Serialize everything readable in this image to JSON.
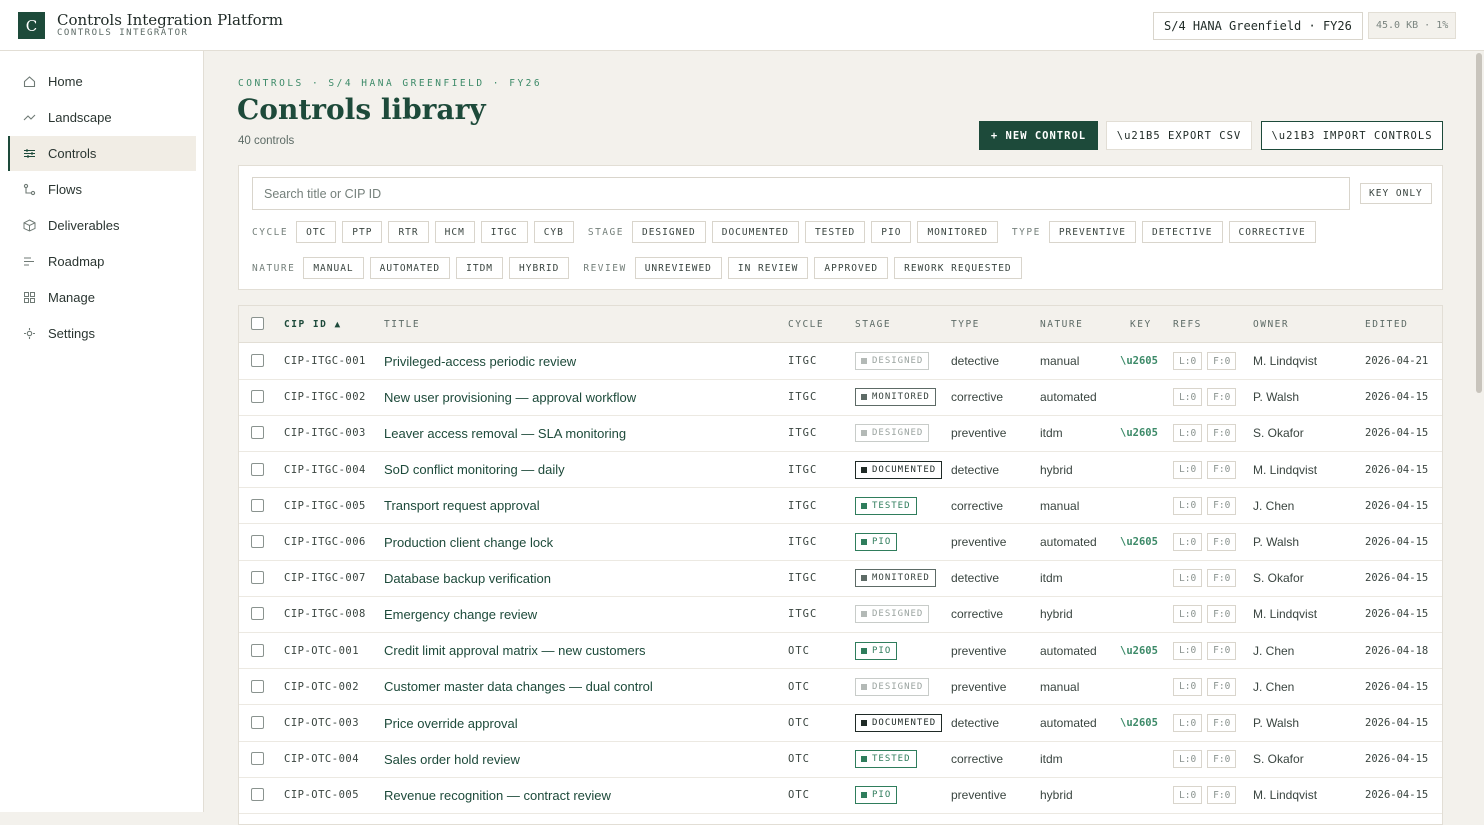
{
  "app": {
    "logo_letter": "C",
    "title": "Controls Integration Platform",
    "subtitle": "CONTROLS INTEGRATOR",
    "project": "S/4 HANA Greenfield · FY26",
    "storage": "45.0 KB · 1%"
  },
  "sidebar": {
    "items": [
      {
        "label": "Home",
        "icon": "home-icon"
      },
      {
        "label": "Landscape",
        "icon": "trend-icon"
      },
      {
        "label": "Controls",
        "icon": "sliders-icon",
        "active": true
      },
      {
        "label": "Flows",
        "icon": "flow-icon"
      },
      {
        "label": "Deliverables",
        "icon": "cube-icon"
      },
      {
        "label": "Roadmap",
        "icon": "roadmap-icon"
      },
      {
        "label": "Manage",
        "icon": "grid-icon"
      },
      {
        "label": "Settings",
        "icon": "gear-icon"
      }
    ]
  },
  "page": {
    "breadcrumb": "CONTROLS · S/4 HANA GREENFIELD · FY26",
    "title": "Controls library",
    "count": "40 controls"
  },
  "actions": {
    "new_control": "+ NEW CONTROL",
    "export_csv": "\\u21B5 EXPORT CSV",
    "import_controls": "\\u21B3 IMPORT CONTROLS"
  },
  "filters": {
    "search_placeholder": "Search title or CIP ID",
    "key_only": "KEY ONLY",
    "cycle_label": "CYCLE",
    "cycle": [
      "OTC",
      "PTP",
      "RTR",
      "HCM",
      "ITGC",
      "CYB"
    ],
    "stage_label": "STAGE",
    "stage": [
      "DESIGNED",
      "DOCUMENTED",
      "TESTED",
      "PIO",
      "MONITORED"
    ],
    "type_label": "TYPE",
    "type": [
      "PREVENTIVE",
      "DETECTIVE",
      "CORRECTIVE"
    ],
    "nature_label": "NATURE",
    "nature": [
      "MANUAL",
      "AUTOMATED",
      "ITDM",
      "HYBRID"
    ],
    "review_label": "REVIEW",
    "review": [
      "UNREVIEWED",
      "IN REVIEW",
      "APPROVED",
      "REWORK REQUESTED"
    ]
  },
  "table": {
    "columns": {
      "cip_id": "CIP ID ▲",
      "title": "TITLE",
      "cycle": "CYCLE",
      "stage": "STAGE",
      "type": "TYPE",
      "nature": "NATURE",
      "key": "KEY",
      "refs": "REFS",
      "owner": "OWNER",
      "edited": "EDITED"
    },
    "rows": [
      {
        "id": "CIP-ITGC-001",
        "title": "Privileged-access periodic review",
        "cycle": "ITGC",
        "stage": "DESIGNED",
        "stage_class": "designed",
        "type": "detective",
        "nature": "manual",
        "key": "\\u2605",
        "ref_l": "L:0",
        "ref_f": "F:0",
        "owner": "M. Lindqvist",
        "edited": "2026-04-21"
      },
      {
        "id": "CIP-ITGC-002",
        "title": "New user provisioning — approval workflow",
        "cycle": "ITGC",
        "stage": "MONITORED",
        "stage_class": "monitored",
        "type": "corrective",
        "nature": "automated",
        "key": "",
        "ref_l": "L:0",
        "ref_f": "F:0",
        "owner": "P. Walsh",
        "edited": "2026-04-15"
      },
      {
        "id": "CIP-ITGC-003",
        "title": "Leaver access removal — SLA monitoring",
        "cycle": "ITGC",
        "stage": "DESIGNED",
        "stage_class": "designed",
        "type": "preventive",
        "nature": "itdm",
        "key": "\\u2605",
        "ref_l": "L:0",
        "ref_f": "F:0",
        "owner": "S. Okafor",
        "edited": "2026-04-15"
      },
      {
        "id": "CIP-ITGC-004",
        "title": "SoD conflict monitoring — daily",
        "cycle": "ITGC",
        "stage": "DOCUMENTED",
        "stage_class": "documented",
        "type": "detective",
        "nature": "hybrid",
        "key": "",
        "ref_l": "L:0",
        "ref_f": "F:0",
        "owner": "M. Lindqvist",
        "edited": "2026-04-15"
      },
      {
        "id": "CIP-ITGC-005",
        "title": "Transport request approval",
        "cycle": "ITGC",
        "stage": "TESTED",
        "stage_class": "tested",
        "type": "corrective",
        "nature": "manual",
        "key": "",
        "ref_l": "L:0",
        "ref_f": "F:0",
        "owner": "J. Chen",
        "edited": "2026-04-15"
      },
      {
        "id": "CIP-ITGC-006",
        "title": "Production client change lock",
        "cycle": "ITGC",
        "stage": "PIO",
        "stage_class": "pio",
        "type": "preventive",
        "nature": "automated",
        "key": "\\u2605",
        "ref_l": "L:0",
        "ref_f": "F:0",
        "owner": "P. Walsh",
        "edited": "2026-04-15"
      },
      {
        "id": "CIP-ITGC-007",
        "title": "Database backup verification",
        "cycle": "ITGC",
        "stage": "MONITORED",
        "stage_class": "monitored",
        "type": "detective",
        "nature": "itdm",
        "key": "",
        "ref_l": "L:0",
        "ref_f": "F:0",
        "owner": "S. Okafor",
        "edited": "2026-04-15"
      },
      {
        "id": "CIP-ITGC-008",
        "title": "Emergency change review",
        "cycle": "ITGC",
        "stage": "DESIGNED",
        "stage_class": "designed",
        "type": "corrective",
        "nature": "hybrid",
        "key": "",
        "ref_l": "L:0",
        "ref_f": "F:0",
        "owner": "M. Lindqvist",
        "edited": "2026-04-15"
      },
      {
        "id": "CIP-OTC-001",
        "title": "Credit limit approval matrix — new customers",
        "cycle": "OTC",
        "stage": "PIO",
        "stage_class": "pio",
        "type": "preventive",
        "nature": "automated",
        "key": "\\u2605",
        "ref_l": "L:0",
        "ref_f": "F:0",
        "owner": "J. Chen",
        "edited": "2026-04-18"
      },
      {
        "id": "CIP-OTC-002",
        "title": "Customer master data changes — dual control",
        "cycle": "OTC",
        "stage": "DESIGNED",
        "stage_class": "designed",
        "type": "preventive",
        "nature": "manual",
        "key": "",
        "ref_l": "L:0",
        "ref_f": "F:0",
        "owner": "J. Chen",
        "edited": "2026-04-15"
      },
      {
        "id": "CIP-OTC-003",
        "title": "Price override approval",
        "cycle": "OTC",
        "stage": "DOCUMENTED",
        "stage_class": "documented",
        "type": "detective",
        "nature": "automated",
        "key": "\\u2605",
        "ref_l": "L:0",
        "ref_f": "F:0",
        "owner": "P. Walsh",
        "edited": "2026-04-15"
      },
      {
        "id": "CIP-OTC-004",
        "title": "Sales order hold review",
        "cycle": "OTC",
        "stage": "TESTED",
        "stage_class": "tested",
        "type": "corrective",
        "nature": "itdm",
        "key": "",
        "ref_l": "L:0",
        "ref_f": "F:0",
        "owner": "S. Okafor",
        "edited": "2026-04-15"
      },
      {
        "id": "CIP-OTC-005",
        "title": "Revenue recognition — contract review",
        "cycle": "OTC",
        "stage": "PIO",
        "stage_class": "pio",
        "type": "preventive",
        "nature": "hybrid",
        "key": "",
        "ref_l": "L:0",
        "ref_f": "F:0",
        "owner": "M. Lindqvist",
        "edited": "2026-04-15"
      }
    ]
  }
}
